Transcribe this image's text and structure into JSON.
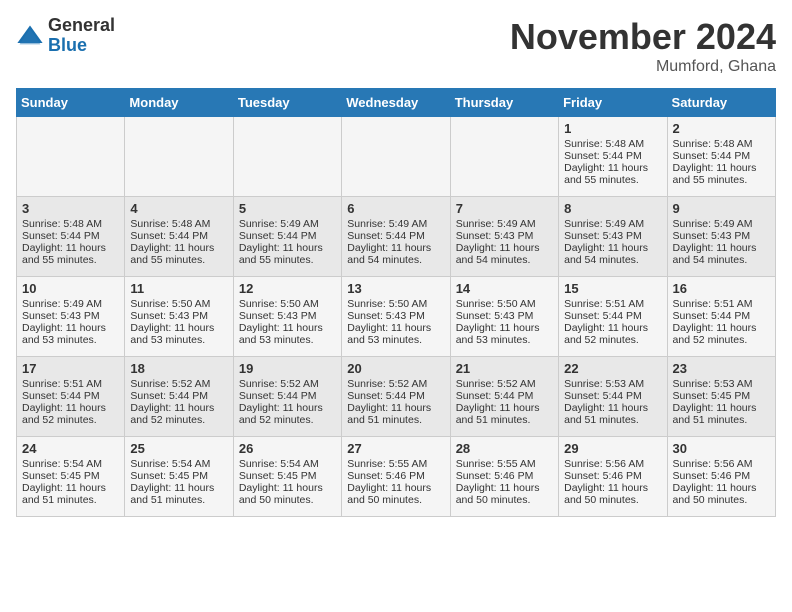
{
  "header": {
    "logo_general": "General",
    "logo_blue": "Blue",
    "month_title": "November 2024",
    "location": "Mumford, Ghana"
  },
  "days_of_week": [
    "Sunday",
    "Monday",
    "Tuesday",
    "Wednesday",
    "Thursday",
    "Friday",
    "Saturday"
  ],
  "weeks": [
    [
      {
        "day": "",
        "info": ""
      },
      {
        "day": "",
        "info": ""
      },
      {
        "day": "",
        "info": ""
      },
      {
        "day": "",
        "info": ""
      },
      {
        "day": "",
        "info": ""
      },
      {
        "day": "1",
        "info": "Sunrise: 5:48 AM\nSunset: 5:44 PM\nDaylight: 11 hours and 55 minutes."
      },
      {
        "day": "2",
        "info": "Sunrise: 5:48 AM\nSunset: 5:44 PM\nDaylight: 11 hours and 55 minutes."
      }
    ],
    [
      {
        "day": "3",
        "info": "Sunrise: 5:48 AM\nSunset: 5:44 PM\nDaylight: 11 hours and 55 minutes."
      },
      {
        "day": "4",
        "info": "Sunrise: 5:48 AM\nSunset: 5:44 PM\nDaylight: 11 hours and 55 minutes."
      },
      {
        "day": "5",
        "info": "Sunrise: 5:49 AM\nSunset: 5:44 PM\nDaylight: 11 hours and 55 minutes."
      },
      {
        "day": "6",
        "info": "Sunrise: 5:49 AM\nSunset: 5:44 PM\nDaylight: 11 hours and 54 minutes."
      },
      {
        "day": "7",
        "info": "Sunrise: 5:49 AM\nSunset: 5:43 PM\nDaylight: 11 hours and 54 minutes."
      },
      {
        "day": "8",
        "info": "Sunrise: 5:49 AM\nSunset: 5:43 PM\nDaylight: 11 hours and 54 minutes."
      },
      {
        "day": "9",
        "info": "Sunrise: 5:49 AM\nSunset: 5:43 PM\nDaylight: 11 hours and 54 minutes."
      }
    ],
    [
      {
        "day": "10",
        "info": "Sunrise: 5:49 AM\nSunset: 5:43 PM\nDaylight: 11 hours and 53 minutes."
      },
      {
        "day": "11",
        "info": "Sunrise: 5:50 AM\nSunset: 5:43 PM\nDaylight: 11 hours and 53 minutes."
      },
      {
        "day": "12",
        "info": "Sunrise: 5:50 AM\nSunset: 5:43 PM\nDaylight: 11 hours and 53 minutes."
      },
      {
        "day": "13",
        "info": "Sunrise: 5:50 AM\nSunset: 5:43 PM\nDaylight: 11 hours and 53 minutes."
      },
      {
        "day": "14",
        "info": "Sunrise: 5:50 AM\nSunset: 5:43 PM\nDaylight: 11 hours and 53 minutes."
      },
      {
        "day": "15",
        "info": "Sunrise: 5:51 AM\nSunset: 5:44 PM\nDaylight: 11 hours and 52 minutes."
      },
      {
        "day": "16",
        "info": "Sunrise: 5:51 AM\nSunset: 5:44 PM\nDaylight: 11 hours and 52 minutes."
      }
    ],
    [
      {
        "day": "17",
        "info": "Sunrise: 5:51 AM\nSunset: 5:44 PM\nDaylight: 11 hours and 52 minutes."
      },
      {
        "day": "18",
        "info": "Sunrise: 5:52 AM\nSunset: 5:44 PM\nDaylight: 11 hours and 52 minutes."
      },
      {
        "day": "19",
        "info": "Sunrise: 5:52 AM\nSunset: 5:44 PM\nDaylight: 11 hours and 52 minutes."
      },
      {
        "day": "20",
        "info": "Sunrise: 5:52 AM\nSunset: 5:44 PM\nDaylight: 11 hours and 51 minutes."
      },
      {
        "day": "21",
        "info": "Sunrise: 5:52 AM\nSunset: 5:44 PM\nDaylight: 11 hours and 51 minutes."
      },
      {
        "day": "22",
        "info": "Sunrise: 5:53 AM\nSunset: 5:44 PM\nDaylight: 11 hours and 51 minutes."
      },
      {
        "day": "23",
        "info": "Sunrise: 5:53 AM\nSunset: 5:45 PM\nDaylight: 11 hours and 51 minutes."
      }
    ],
    [
      {
        "day": "24",
        "info": "Sunrise: 5:54 AM\nSunset: 5:45 PM\nDaylight: 11 hours and 51 minutes."
      },
      {
        "day": "25",
        "info": "Sunrise: 5:54 AM\nSunset: 5:45 PM\nDaylight: 11 hours and 51 minutes."
      },
      {
        "day": "26",
        "info": "Sunrise: 5:54 AM\nSunset: 5:45 PM\nDaylight: 11 hours and 50 minutes."
      },
      {
        "day": "27",
        "info": "Sunrise: 5:55 AM\nSunset: 5:46 PM\nDaylight: 11 hours and 50 minutes."
      },
      {
        "day": "28",
        "info": "Sunrise: 5:55 AM\nSunset: 5:46 PM\nDaylight: 11 hours and 50 minutes."
      },
      {
        "day": "29",
        "info": "Sunrise: 5:56 AM\nSunset: 5:46 PM\nDaylight: 11 hours and 50 minutes."
      },
      {
        "day": "30",
        "info": "Sunrise: 5:56 AM\nSunset: 5:46 PM\nDaylight: 11 hours and 50 minutes."
      }
    ]
  ]
}
